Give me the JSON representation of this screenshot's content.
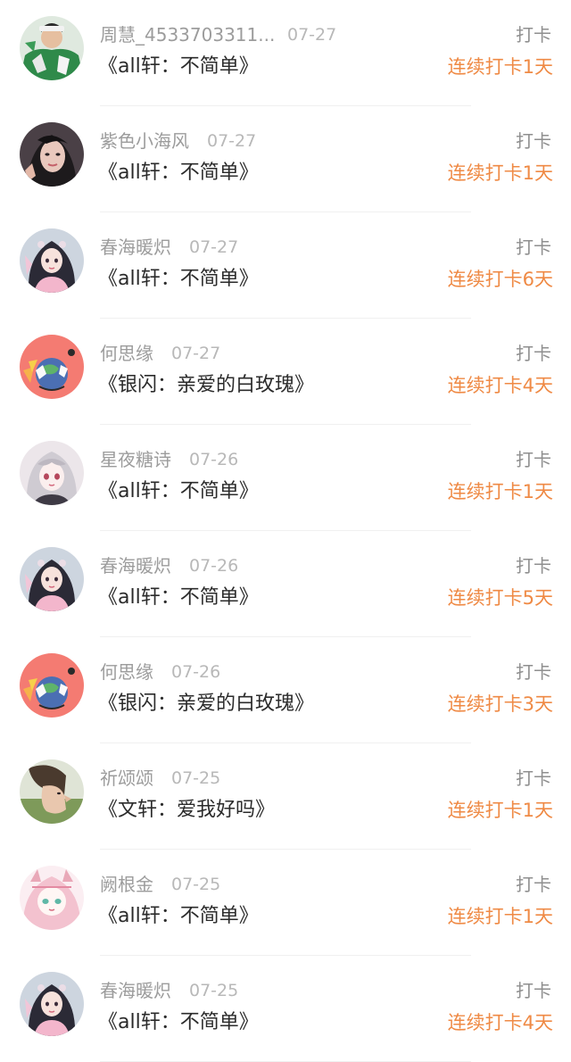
{
  "checkins": [
    {
      "user": "周慧_4533703311...",
      "date": "07-27",
      "title": "《all轩：不简单》",
      "action": "打卡",
      "streak": "连续打卡1天",
      "avatar_icon": "avatar-man-green-jersey"
    },
    {
      "user": "紫色小海风",
      "date": "07-27",
      "title": "《all轩：不简单》",
      "action": "打卡",
      "streak": "连续打卡1天",
      "avatar_icon": "avatar-woman-portrait"
    },
    {
      "user": "春海暖炽",
      "date": "07-27",
      "title": "《all轩：不简单》",
      "action": "打卡",
      "streak": "连续打卡6天",
      "avatar_icon": "avatar-anime-girl-pink"
    },
    {
      "user": "何思缘",
      "date": "07-27",
      "title": "《银闪：亲爱的白玫瑰》",
      "action": "打卡",
      "streak": "连续打卡4天",
      "avatar_icon": "avatar-pink-monster"
    },
    {
      "user": "星夜糖诗",
      "date": "07-26",
      "title": "《all轩：不简单》",
      "action": "打卡",
      "streak": "连续打卡1天",
      "avatar_icon": "avatar-anime-girl-silver"
    },
    {
      "user": "春海暖炽",
      "date": "07-26",
      "title": "《all轩：不简单》",
      "action": "打卡",
      "streak": "连续打卡5天",
      "avatar_icon": "avatar-anime-girl-pink"
    },
    {
      "user": "何思缘",
      "date": "07-26",
      "title": "《银闪：亲爱的白玫瑰》",
      "action": "打卡",
      "streak": "连续打卡3天",
      "avatar_icon": "avatar-pink-monster"
    },
    {
      "user": "祈颂颂",
      "date": "07-25",
      "title": "《文轩：爱我好吗》",
      "action": "打卡",
      "streak": "连续打卡1天",
      "avatar_icon": "avatar-boy-side-profile"
    },
    {
      "user": "阙根金",
      "date": "07-25",
      "title": "《all轩：不简单》",
      "action": "打卡",
      "streak": "连续打卡1天",
      "avatar_icon": "avatar-anime-girl-cat-ears"
    },
    {
      "user": "春海暖炽",
      "date": "07-25",
      "title": "《all轩：不简单》",
      "action": "打卡",
      "streak": "连续打卡4天",
      "avatar_icon": "avatar-anime-girl-pink"
    }
  ]
}
